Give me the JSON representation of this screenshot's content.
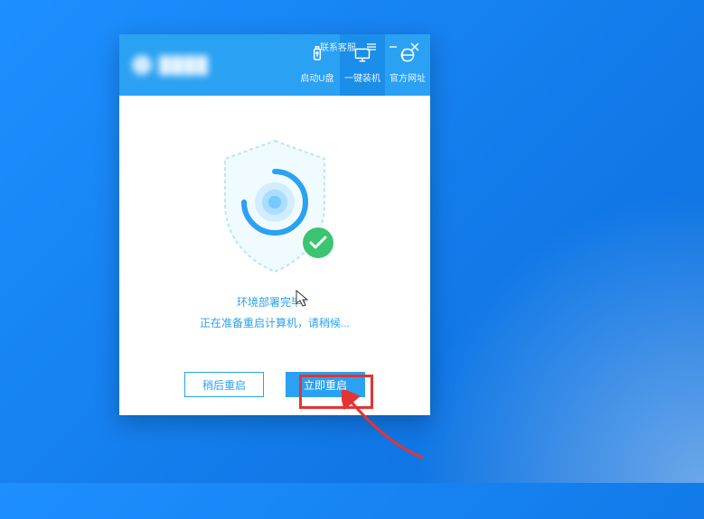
{
  "windowControls": {
    "contactSupport": "联系客服"
  },
  "tabs": {
    "bootUDisk": "启动U盘",
    "oneClickInstall": "一键装机",
    "officialSite": "官方网址"
  },
  "status": {
    "line1": "环境部署完毕！",
    "line2": "正在准备重启计算机，请稍候..."
  },
  "buttons": {
    "later": "稍后重启",
    "now": "立即重启"
  }
}
